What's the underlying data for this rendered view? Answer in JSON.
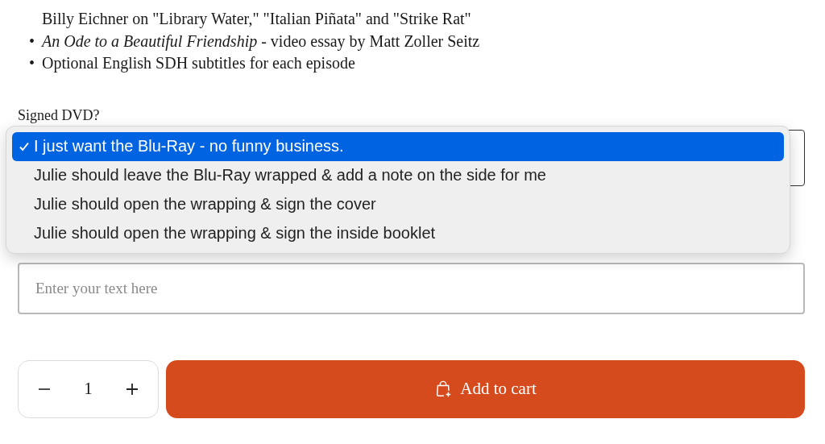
{
  "features": [
    {
      "text": "Billy Eichner on \"Library Water,\" \"Italian Piñata\" and \"Strike Rat\""
    },
    {
      "marker": "•",
      "text": "*An Ode to a Beautiful Friendship* - video essay by Matt Zoller Seitz"
    },
    {
      "marker": "•",
      "text": "Optional English SDH subtitles for each episode"
    }
  ],
  "signed_dvd": {
    "label": "Signed DVD?",
    "options": [
      {
        "label": "I just want the Blu-Ray - no funny business.",
        "selected": true
      },
      {
        "label": "Julie should leave the Blu-Ray wrapped & add a note on the side for me",
        "selected": false
      },
      {
        "label": "Julie should open the wrapping & sign the cover",
        "selected": false
      },
      {
        "label": "Julie should open the wrapping & sign the inside booklet",
        "selected": false
      }
    ]
  },
  "note_field": {
    "placeholder": "Enter your text here"
  },
  "quantity": {
    "value": "1"
  },
  "add_to_cart": {
    "label": "Add to cart"
  }
}
